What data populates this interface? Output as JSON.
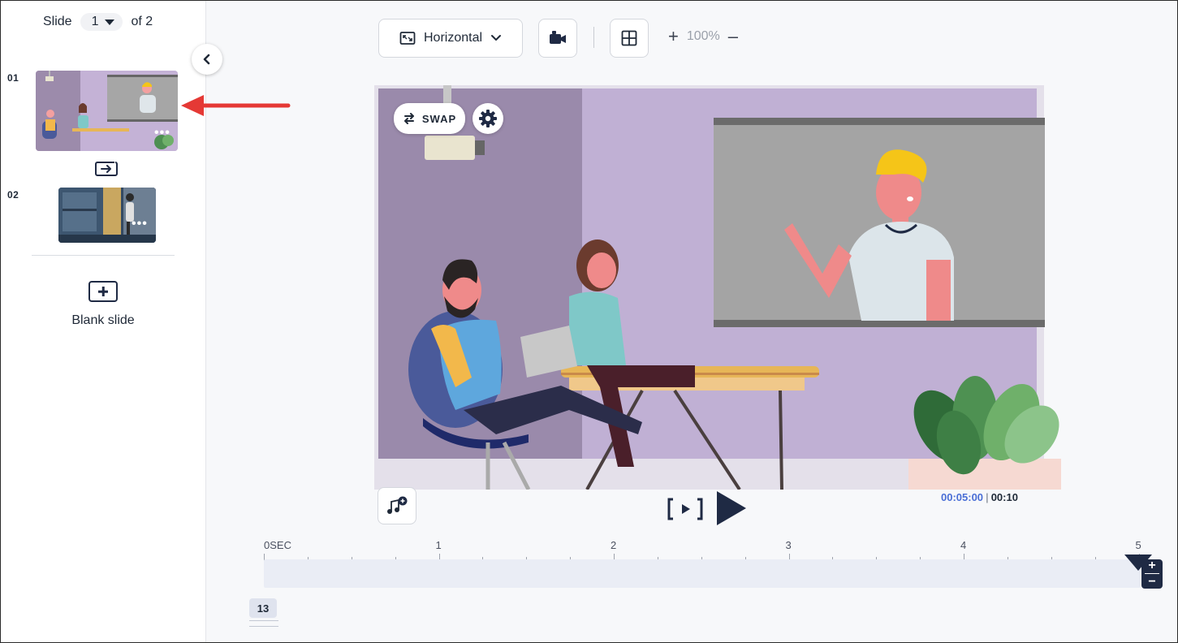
{
  "sidebar": {
    "slide_label": "Slide",
    "current_slide": "1",
    "total_label": "of 2",
    "slides": [
      {
        "number": "01"
      },
      {
        "number": "02"
      }
    ],
    "blank_slide_label": "Blank slide"
  },
  "toolbar": {
    "orientation_label": "Horizontal",
    "zoom_level": "100%",
    "zoom_in": "+",
    "zoom_out": "–"
  },
  "canvas": {
    "swap_label": "SWAP"
  },
  "player": {
    "current_time": "00:05:00",
    "separator": "|",
    "total_time": "00:10"
  },
  "timeline": {
    "labels": [
      "0SEC",
      "1",
      "2",
      "3",
      "4",
      "5"
    ],
    "track_badge": "13",
    "zoom_plus": "+",
    "zoom_minus": "−"
  },
  "colors": {
    "accent_blue": "#4a6fd6",
    "navy": "#1f2a44",
    "annotation_red": "#e53935",
    "scene_purple": "#c0b0d4"
  }
}
